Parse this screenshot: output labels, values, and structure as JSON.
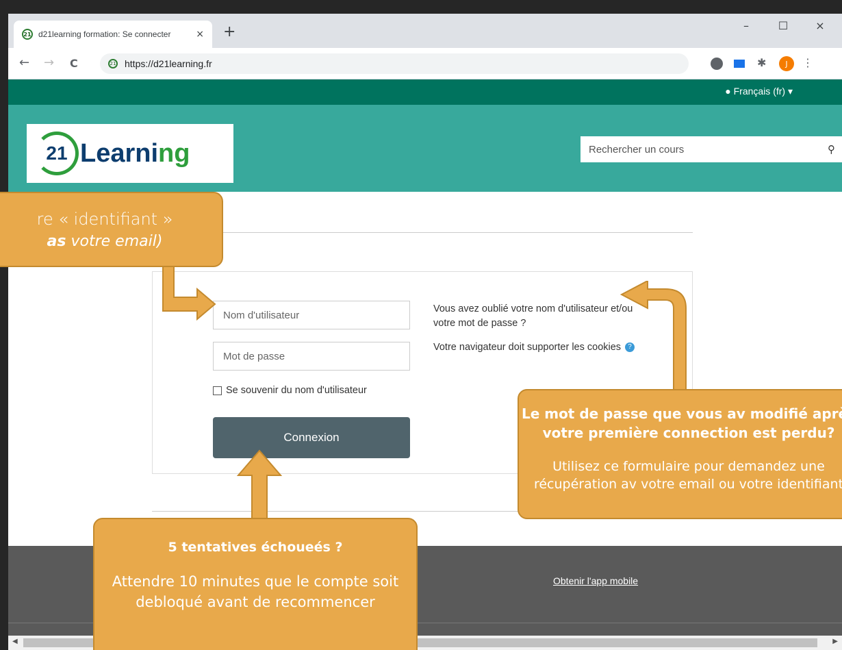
{
  "browser": {
    "tab_title": "d21learning formation: Se connecter",
    "tab_close": "×",
    "new_tab": "+",
    "url": "https://d21learning.fr",
    "window_controls": {
      "minimize": "–",
      "maximize": "☐",
      "close": "×"
    },
    "nav": {
      "back": "←",
      "forward": "→",
      "reload": "C"
    },
    "profile_initial": "J",
    "favicon_text": "21"
  },
  "site": {
    "language_label": "Français (fr)",
    "logo": {
      "number": "21",
      "word_part1": "Learni",
      "word_part2": "ng"
    },
    "search_placeholder": "Rechercher un cours",
    "login": {
      "username_placeholder": "Nom d'utilisateur",
      "password_placeholder": "Mot de passe",
      "remember_label": "Se souvenir du nom d'utilisateur",
      "submit_label": "Connexion",
      "forgot_text": "Vous avez oublié votre nom d'utilisateur et/ou votre mot de passe ?",
      "cookies_text": "Votre navigateur doit supporter les cookies"
    },
    "footer": {
      "mobile_app_link": "Obtenir l'app mobile"
    }
  },
  "callouts": {
    "identifier": {
      "line1": "re « identifiant »",
      "line2_bold": "as",
      "line2_rest": " votre email)"
    },
    "password": {
      "heading": "Le mot de passe que vous av modifié après votre première connection est perdu?",
      "text": "Utilisez ce formulaire pour demandez une récupération av votre email ou votre identifiant"
    },
    "attempts": {
      "heading": "5 tentatives échoueés ?",
      "text": "Attendre 10 minutes que le compte soit debloqué avant de recommencer"
    }
  },
  "colors": {
    "lang_bar": "#00735e",
    "header": "#38a99c",
    "button": "#50646c",
    "callout": "#e8a94b",
    "footer": "#5a5a5a"
  }
}
